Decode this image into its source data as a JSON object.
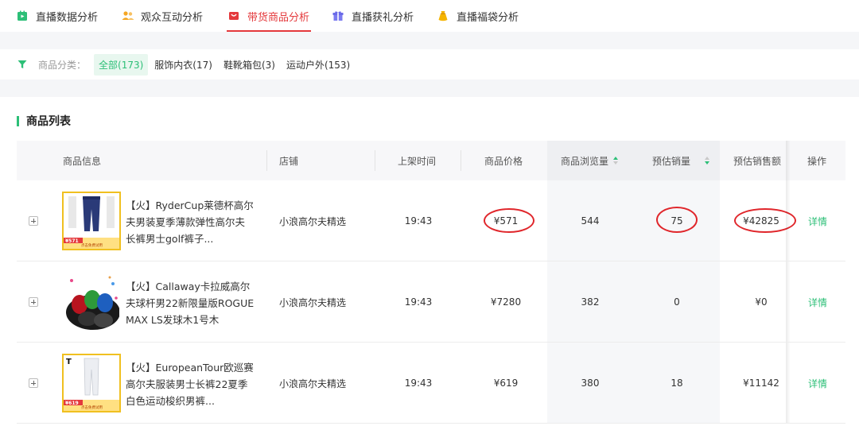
{
  "tabs": [
    {
      "label": "直播数据分析",
      "icon": "live-data-icon"
    },
    {
      "label": "观众互动分析",
      "icon": "audience-icon"
    },
    {
      "label": "带货商品分析",
      "icon": "product-icon"
    },
    {
      "label": "直播获礼分析",
      "icon": "gift-icon"
    },
    {
      "label": "直播福袋分析",
      "icon": "lucky-bag-icon"
    }
  ],
  "active_tab_index": 2,
  "filter": {
    "label": "商品分类：",
    "chips": [
      "全部(173)",
      "服饰内衣(17)",
      "鞋靴箱包(3)",
      "运动户外(153)"
    ],
    "active_index": 0
  },
  "section": {
    "title": "商品列表"
  },
  "table": {
    "headers": {
      "info": "商品信息",
      "shop": "店铺",
      "time": "上架时间",
      "price": "商品价格",
      "views": "商品浏览量",
      "sales": "预估销量",
      "revenue": "预估销售额",
      "action": "操作"
    },
    "rows": [
      {
        "name": "【火】RyderCup莱德杯高尔夫男装夏季薄款弹性高尔夫长裤男士golf裤子...",
        "shop": "小浪高尔夫精选",
        "time": "19:43",
        "price": "¥571",
        "views": "544",
        "sales": "75",
        "revenue": "¥42825",
        "action": "详情",
        "thumb_tag": "¥571",
        "thumb_caption": "点击免费试用"
      },
      {
        "name": "【火】Callaway卡拉威高尔夫球杆男22新限量版ROGUE MAX LS发球木1号木",
        "shop": "小浪高尔夫精选",
        "time": "19:43",
        "price": "¥7280",
        "views": "382",
        "sales": "0",
        "revenue": "¥0",
        "action": "详情",
        "thumb_tag": "",
        "thumb_caption": ""
      },
      {
        "name": "【火】EuropeanTour欧巡赛高尔夫服装男士长裤22夏季白色运动梭织男裤...",
        "shop": "小浪高尔夫精选",
        "time": "19:43",
        "price": "¥619",
        "views": "380",
        "sales": "18",
        "revenue": "¥11142",
        "action": "详情",
        "thumb_tag": "¥619",
        "thumb_caption": "点击免费试用"
      }
    ]
  },
  "colors": {
    "accent_red": "#e4393c",
    "accent_green": "#2cbf77",
    "annotation_red": "#e0262b"
  }
}
